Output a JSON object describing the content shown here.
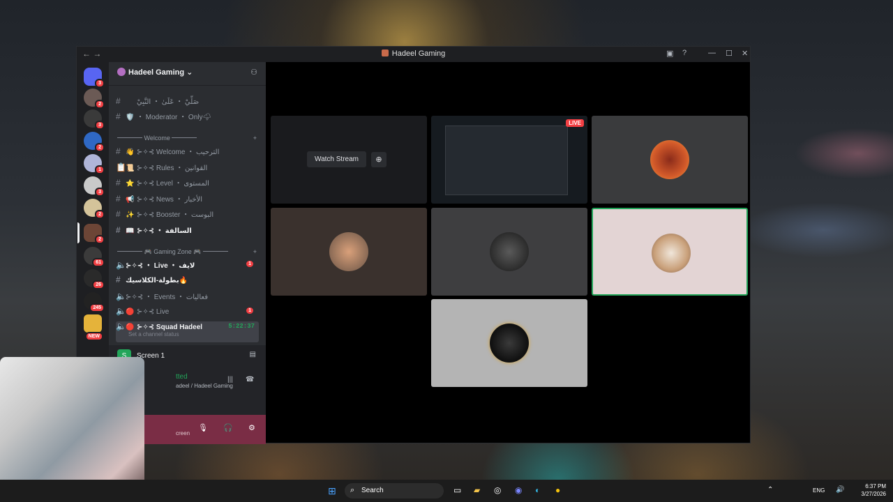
{
  "window": {
    "title": "Hadeel Gaming"
  },
  "server": {
    "name": "Hadeel Gaming"
  },
  "servers": [
    {
      "badge": "3"
    },
    {
      "badge": "2"
    },
    {
      "badge": "3"
    },
    {
      "badge": "2"
    },
    {
      "badge": "1"
    },
    {
      "badge": "3"
    },
    {
      "badge": "2"
    },
    {
      "badge": "2"
    },
    {
      "badge": "61"
    },
    {
      "badge": "26"
    },
    {
      "badge": "245"
    },
    {
      "badge": "NEW"
    }
  ],
  "channels": [
    {
      "hash": "#",
      "emoji": "",
      "label": "صَلِّيْ ・ عَلَىٰ ・ النَّبِيْ",
      "bold": false
    },
    {
      "hash": "#",
      "emoji": "🛡️",
      "label": "・ Moderator ・ Only🌩",
      "bold": false
    },
    {
      "cat": true,
      "label": "Welcome"
    },
    {
      "hash": "#",
      "emoji": "👋",
      "label": "⊱✧⊰ Welcome ・ الترحيب",
      "bold": false
    },
    {
      "hash": "📋",
      "emoji": "📜",
      "label": "⊱✧⊰ Rules ・ القوانين",
      "bold": false
    },
    {
      "hash": "#",
      "emoji": "⭐",
      "label": "⊱✧⊰ Level ・ المستوى",
      "bold": false
    },
    {
      "hash": "#",
      "emoji": "📢",
      "label": "⊱✧⊰ News ・ الأخبار",
      "bold": false
    },
    {
      "hash": "#",
      "emoji": "✨",
      "label": "⊱✧⊰ Booster ・ البوست",
      "bold": false
    },
    {
      "hash": "#",
      "emoji": "📖",
      "label": "⊱✧⊰ ・ السالفة",
      "bold": true
    },
    {
      "cat": true,
      "label": "🎮 Gaming Zone 🎮"
    },
    {
      "hash": "🔈",
      "emoji": "",
      "label": "⊱✧⊰ ・ Live ・ لايف",
      "bold": true,
      "count": "1"
    },
    {
      "hash": "#",
      "emoji": "",
      "label": "بطولة-الكلاسيك🔥",
      "bold": true
    },
    {
      "hash": "🔈",
      "emoji": "",
      "label": "⊱✧⊰ ・ Events ・ فعاليات",
      "bold": false
    },
    {
      "hash": "🔈",
      "emoji": "🔴",
      "label": "⊱✧⊰ Live",
      "bold": false,
      "count": "1"
    },
    {
      "hash": "🔈",
      "emoji": "🔴",
      "label": "⊱✧⊰ Squad Hadeel",
      "bold": true,
      "time": "5:22:37",
      "status": "Set a channel status"
    }
  ],
  "screen": {
    "label": "Screen 1"
  },
  "voice": {
    "state": "tted",
    "sub": "adeel / Hadeel Gaming",
    "footer": "creen"
  },
  "stream": {
    "watch_label": "Watch Stream",
    "live_label": "LIVE"
  },
  "taskbar": {
    "search": "Search",
    "lang": "ENG",
    "time": "6:37 PM",
    "date": "3/27/2026"
  }
}
